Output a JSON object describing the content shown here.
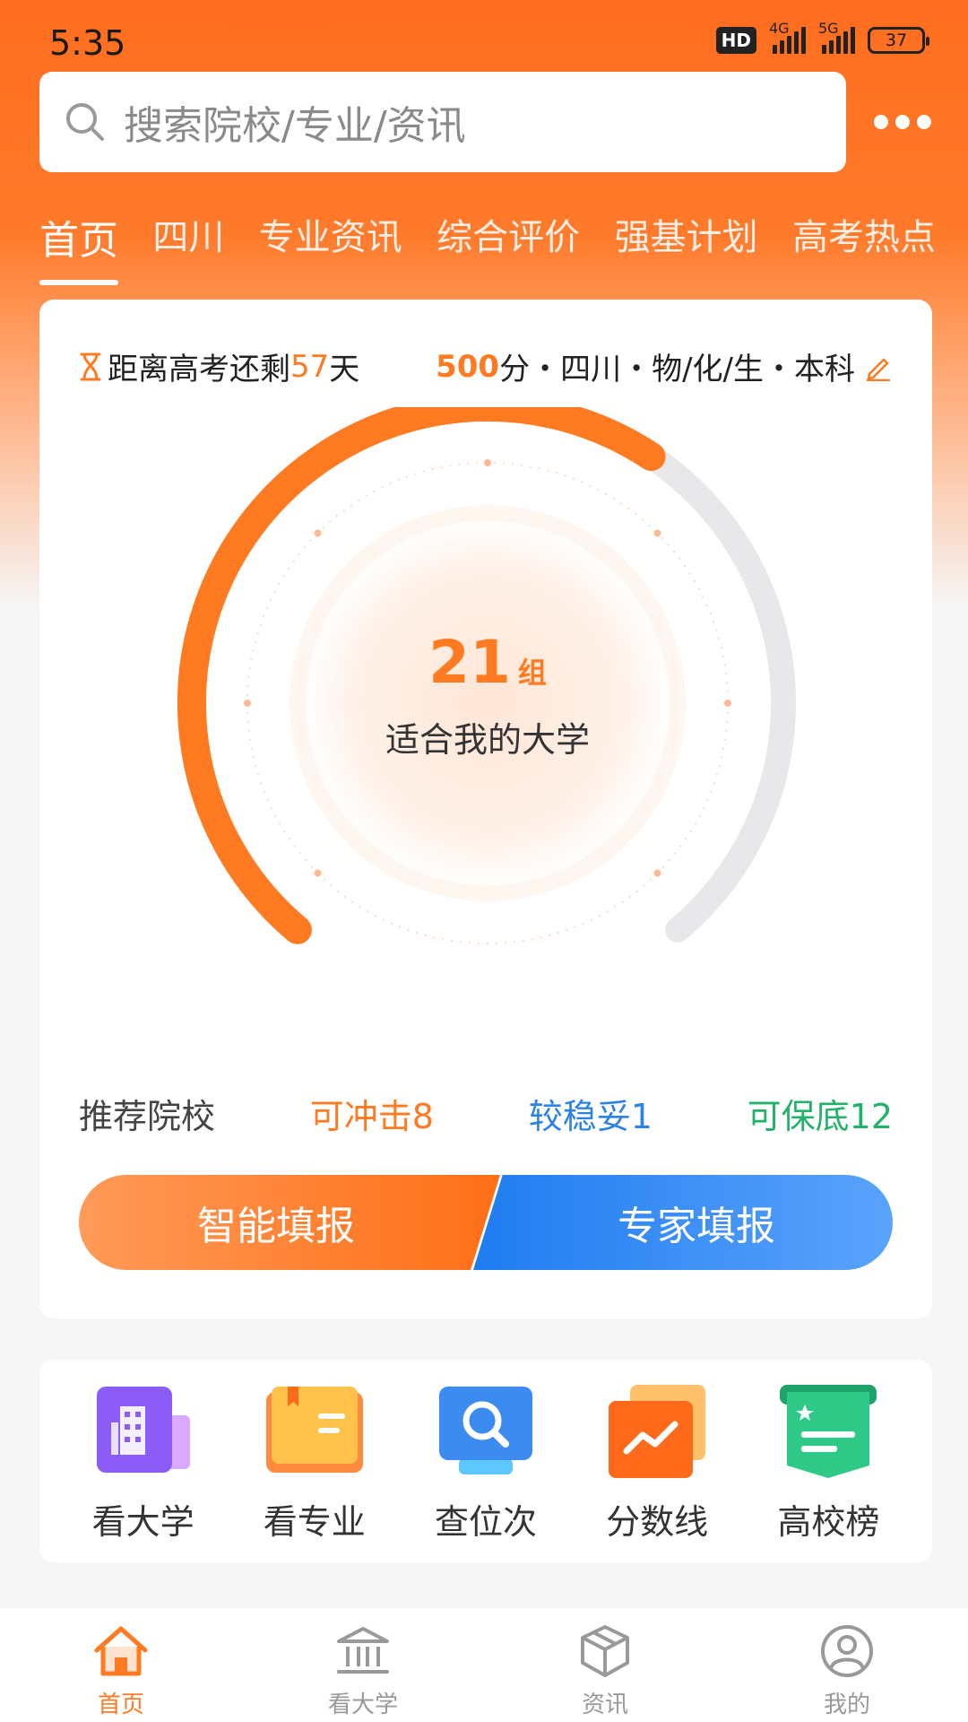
{
  "status_bar": {
    "time": "5:35",
    "hd_badge": "HD",
    "network1": "4G",
    "network2": "5G",
    "battery": "37"
  },
  "search": {
    "placeholder": "搜索院校/专业/资讯"
  },
  "tabs": [
    {
      "label": "首页",
      "active": true
    },
    {
      "label": "四川"
    },
    {
      "label": "专业资讯"
    },
    {
      "label": "综合评价"
    },
    {
      "label": "强基计划"
    },
    {
      "label": "高考热点"
    }
  ],
  "exam_info": {
    "countdown_prefix": "距离高考还剩",
    "days_left": "57",
    "days_unit": "天",
    "score": "500",
    "profile_suffix": "分・四川・物/化/生・本科"
  },
  "dial": {
    "count": "21",
    "unit": "组",
    "caption": "适合我的大学",
    "fill_fraction": 0.62,
    "accent_color": "#ff7a20",
    "track_color": "#e8e8ea"
  },
  "recommend": {
    "title": "推荐院校",
    "chong": "可冲击8",
    "wen": "较稳妥1",
    "bao": "可保底12"
  },
  "buttons": {
    "smart_fill": "智能填报",
    "expert_fill": "专家填报"
  },
  "quick_nav": [
    {
      "label": "看大学",
      "icon": "building-icon"
    },
    {
      "label": "看专业",
      "icon": "open-book-icon"
    },
    {
      "label": "查位次",
      "icon": "search-monitor-icon"
    },
    {
      "label": "分数线",
      "icon": "trend-chart-icon"
    },
    {
      "label": "高校榜",
      "icon": "ranking-badge-icon"
    }
  ],
  "bottom_nav": [
    {
      "label": "首页",
      "icon": "home-icon",
      "active": true
    },
    {
      "label": "看大学",
      "icon": "university-icon"
    },
    {
      "label": "资讯",
      "icon": "box-icon"
    },
    {
      "label": "我的",
      "icon": "profile-icon"
    }
  ]
}
